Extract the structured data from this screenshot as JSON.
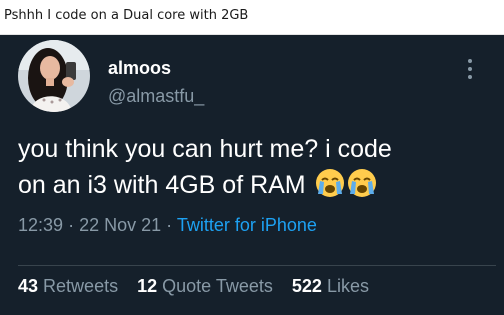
{
  "caption": "Pshhh I code on a Dual core with 2GB",
  "tweet": {
    "display_name": "almoos",
    "handle": "@almastfu_",
    "text_line1": "you think you can hurt me? i code",
    "text_line2": "on an i3 with 4GB of RAM",
    "emoji": [
      "crying-face-emoji",
      "crying-face-emoji"
    ],
    "time": "12:39",
    "date": "22 Nov 21",
    "separator": "·",
    "source": "Twitter for iPhone",
    "stats": {
      "retweets_count": "43",
      "retweets_label": "Retweets",
      "quote_count": "12",
      "quote_label": "Quote Tweets",
      "likes_count": "522",
      "likes_label": "Likes"
    }
  },
  "colors": {
    "background": "#15202b",
    "text_primary": "#ffffff",
    "text_secondary": "#8899a6",
    "link": "#1da1f2",
    "divider": "#38444d"
  },
  "icons": {
    "more": "more-vertical-icon"
  }
}
